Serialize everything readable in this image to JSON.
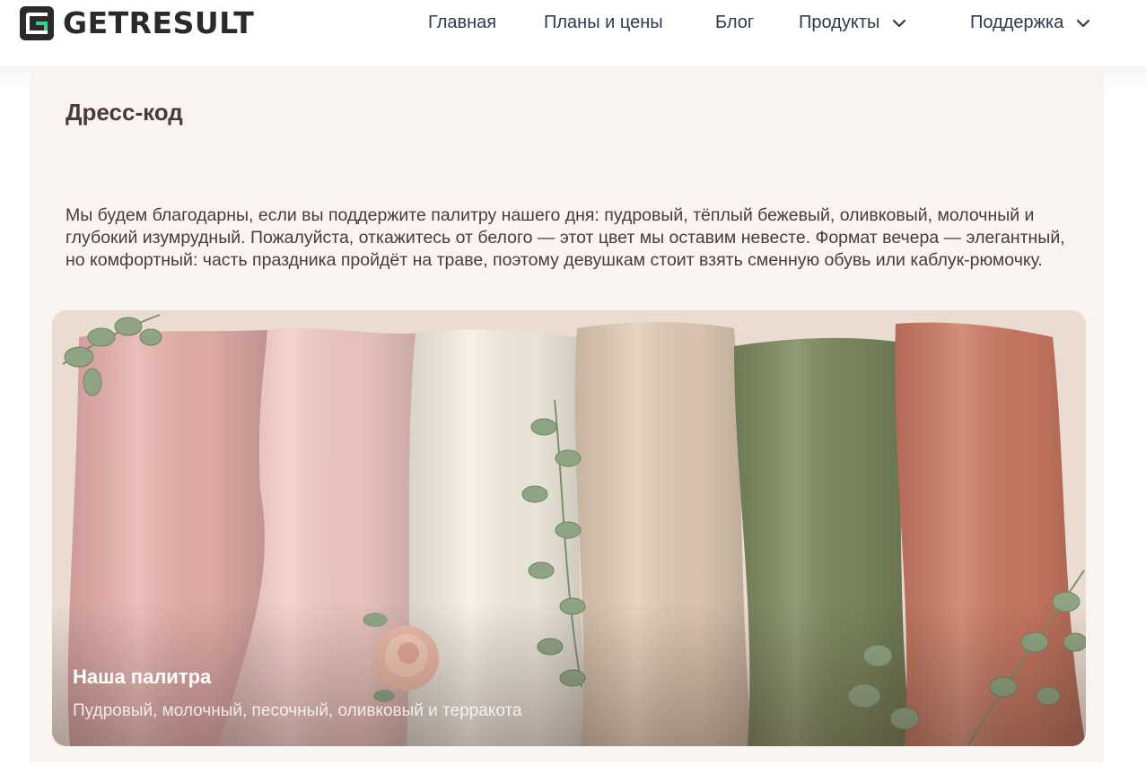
{
  "header": {
    "logo_text": "GETRESULT",
    "nav": [
      {
        "label": "Главная",
        "has_dropdown": false
      },
      {
        "label": "Планы и цены",
        "has_dropdown": false
      },
      {
        "label": "Блог",
        "has_dropdown": false
      },
      {
        "label": "Продукты",
        "has_dropdown": true
      },
      {
        "label": "Поддержка",
        "has_dropdown": true
      }
    ]
  },
  "section": {
    "title": "Дресс-код",
    "text": "Мы будем благодарны, если вы поддержите палитру нашего дня: пудровый, тёплый бежевый, оливковый, молочный и глубокий изумрудный. Пожалуйста, откажитесь от белого — этот цвет мы оставим невесте. Формат вечера — элегантный, но комфортный: часть праздника пройдёт на траве, поэтому девушкам стоит взять сменную обувь или каблук-рюмочку."
  },
  "card": {
    "title": "Наша палитра",
    "subtitle": "Пудровый, молочный, песочный, оливковый и терракота",
    "fabric_colors": [
      "#e9b1ae",
      "#f3cbc6",
      "#f6efe3",
      "#e2cdb7",
      "#7d8a5f",
      "#cc7a63"
    ]
  },
  "colors": {
    "section_bg": "#f9f4f2",
    "text": "#4a3a3e",
    "nav_text": "#2d3a4a",
    "logo_accent": "#3ccf8e"
  }
}
